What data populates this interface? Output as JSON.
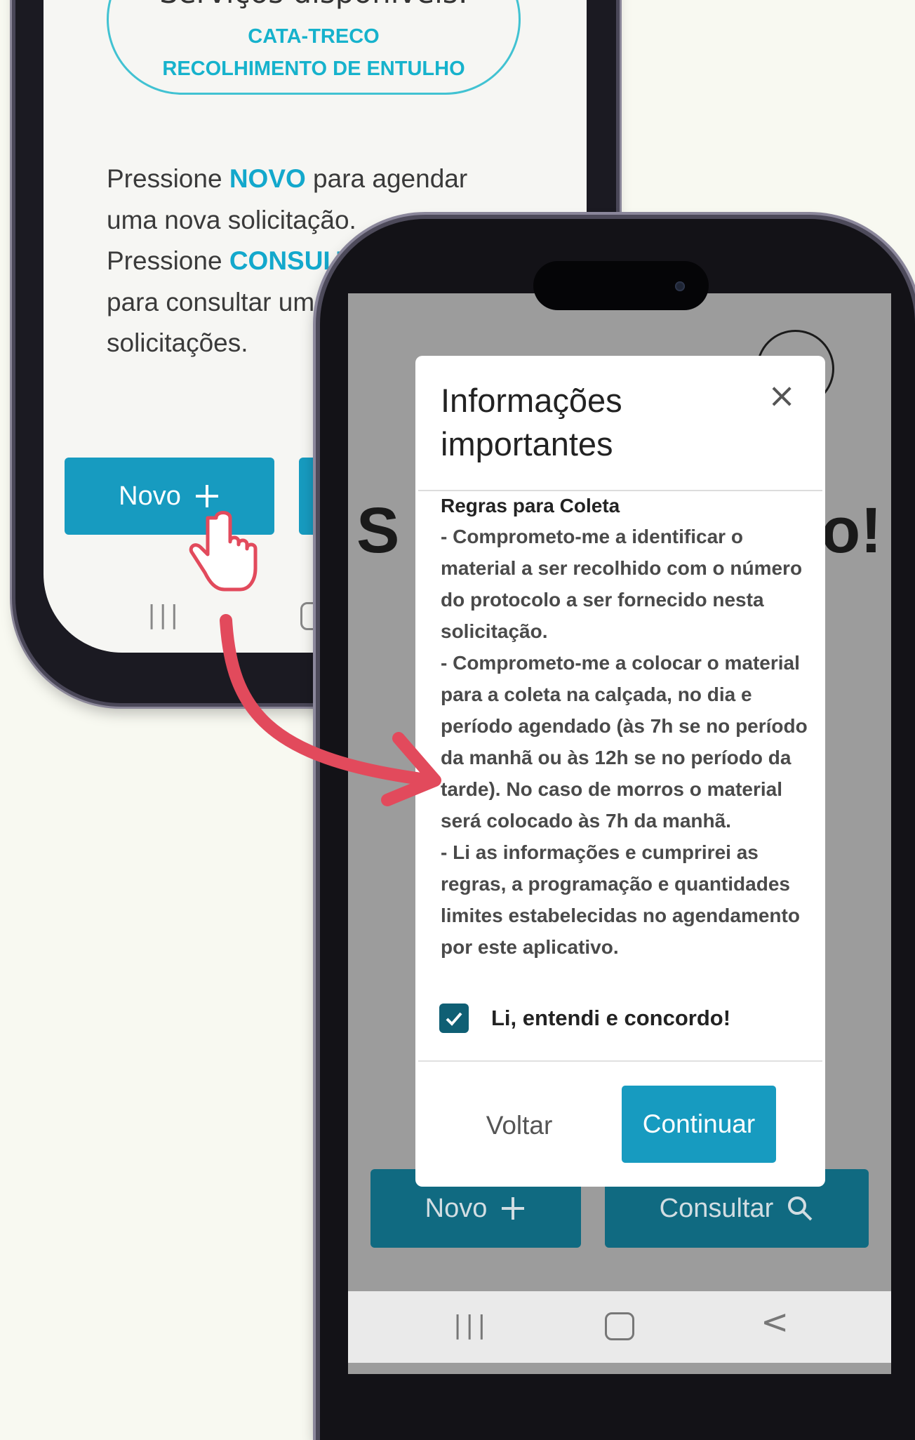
{
  "back_phone": {
    "services_title": "Serviços disponíveis:",
    "services": [
      "CATA-TRECO",
      "RECOLHIMENTO DE ENTULHO"
    ],
    "instructions": {
      "line1_pre": "Pressione ",
      "line1_key": "NOVO",
      "line1_post": " para agendar",
      "line2": "uma nova solicitação.",
      "line3_pre": "Pressione ",
      "line3_key": "CONSULT",
      "line4": "para consultar um",
      "line5": "solicitações."
    },
    "novo_label": "Novo",
    "navbar_recents": "|||"
  },
  "front_phone": {
    "bg_heading_start": "S",
    "bg_heading_end": "o!",
    "novo_label": "Novo",
    "consultar_label": "Consultar",
    "navbar_recents": "|||",
    "navbar_back": "<"
  },
  "modal": {
    "title": "Informações importantes",
    "close": "×",
    "rules_heading": "Regras para Coleta",
    "rules": [
      "- Comprometo-me a identificar o material a ser recolhido com o número do protocolo a ser fornecido nesta solicitação.",
      "- Comprometo-me a colocar o material para a coleta na calçada, no dia e período agendado (às 7h se no período da manhã ou às 12h se no período da tarde). No caso de morros o material será colocado às 7h da manhã.",
      "- Li as informações e cumprirei as regras, a programação e quantidades limites estabelecidas no agendamento por este aplicativo."
    ],
    "agree_label": "Li, entendi e concordo!",
    "agree_checked": true,
    "back_button": "Voltar",
    "continue_button": "Continuar"
  },
  "colors": {
    "accent": "#179bc0",
    "accent_dark": "#106a81",
    "highlight_text": "#13a8cc",
    "arrow": "#e24a5c",
    "checkbox": "#0f5f74"
  },
  "icons": [
    "plus-icon",
    "search-icon",
    "close-icon",
    "check-icon",
    "hand-pointer-icon",
    "curved-arrow-icon",
    "profile-icon"
  ]
}
